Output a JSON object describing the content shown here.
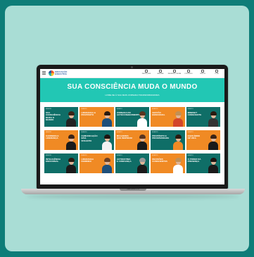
{
  "site": {
    "logo_text": "EDUCAÇÃO EXECUTIVA",
    "nav": [
      {
        "label": "INSCRIÇÕES",
        "icon": "ticket-icon"
      },
      {
        "label": "AGENDA",
        "icon": "calendar-icon"
      },
      {
        "label": "REUNIÕES ONLINE",
        "icon": "users-icon"
      },
      {
        "label": "CONTEÚDO",
        "icon": "book-icon"
      },
      {
        "label": "VÍDEOS",
        "icon": "video-icon"
      },
      {
        "label": "LOJA",
        "icon": "cart-icon"
      }
    ]
  },
  "banner": {
    "title": "SUA CONSCIÊNCIA MUDA O MUNDO",
    "subtitle": "LIVRE-SE À SUA MAIS JORNADA TRANSFORMADORA"
  },
  "laptop": {
    "model_label": "MacBook Pro"
  },
  "tiles": [
    {
      "tag": "EVENTO",
      "title": "Sua consciência muda o mundo",
      "bg": "#0f6e67",
      "hair": "#3b2417",
      "shirt": "#222222"
    },
    {
      "tag": "EVENTO",
      "title": "Liderança & Propósito",
      "bg": "#f08a24",
      "hair": "#2a1a10",
      "shirt": "#1e4f7a"
    },
    {
      "tag": "EVENTO",
      "title": "Jornada do Autoconhecimento",
      "bg": "#0f6e67",
      "hair": "#5a3520",
      "shirt": "#ffffff"
    },
    {
      "tag": "EVENTO",
      "title": "Gestão Emocional",
      "bg": "#f08a24",
      "hair": "#c29055",
      "shirt": "#d3452b"
    },
    {
      "tag": "EVENTO",
      "title": "Mindset Consciente",
      "bg": "#0f6e67",
      "hair": "#2a1a10",
      "shirt": "#333333"
    },
    {
      "tag": "EVENTO",
      "title": "Carreira e Liderança",
      "bg": "#f08a24",
      "hair": "#3b2417",
      "shirt": "#1a1a1a"
    },
    {
      "tag": "EVENTO",
      "title": "Comunicação Não-Violenta",
      "bg": "#0f6e67",
      "hair": "#1e1410",
      "shirt": "#f2f2f2"
    },
    {
      "tag": "EVENTO",
      "title": "Mulheres que Inspiram",
      "bg": "#f08a24",
      "hair": "#5a3520",
      "shirt": "#1a1a1a"
    },
    {
      "tag": "EVENTO",
      "title": "Propósito e Prosperidade",
      "bg": "#0f6e67",
      "hair": "#2a1a10",
      "shirt": "#f08a24"
    },
    {
      "tag": "EVENTO",
      "title": "Equilíbrio de Vida",
      "bg": "#f08a24",
      "hair": "#3b2417",
      "shirt": "#1a1a1a"
    },
    {
      "tag": "EVENTO",
      "title": "Inteligência Emocional",
      "bg": "#0f6e67",
      "hair": "#2a1a10",
      "shirt": "#1a1a1a"
    },
    {
      "tag": "EVENTO",
      "title": "Liderança Feminina",
      "bg": "#f08a24",
      "hair": "#6b4024",
      "shirt": "#1e4f7a"
    },
    {
      "tag": "EVENTO",
      "title": "Autoestima e Confiança",
      "bg": "#0f6e67",
      "hair": "#999999",
      "shirt": "#1a1a1a"
    },
    {
      "tag": "EVENTO",
      "title": "Decisões Conscientes",
      "bg": "#f08a24",
      "hair": "#c29055",
      "shirt": "#ffffff"
    },
    {
      "tag": "EVENTO",
      "title": "O Poder da Presença",
      "bg": "#0f6e67",
      "hair": "#1e1410",
      "shirt": "#1a1a1a"
    }
  ]
}
